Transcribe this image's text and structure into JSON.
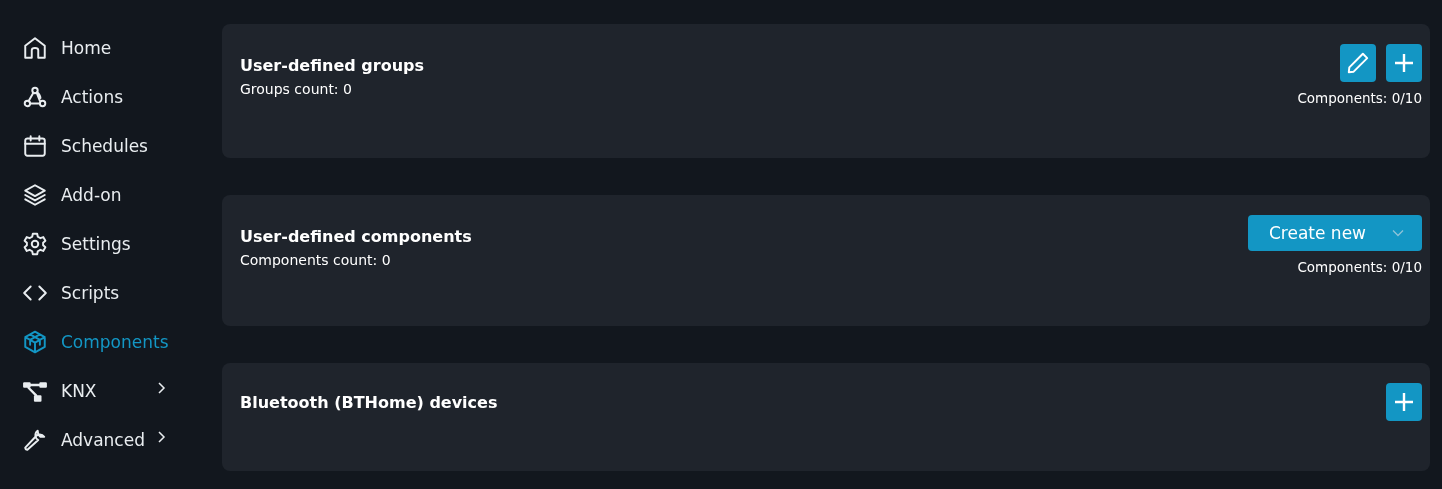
{
  "sidebar": {
    "items": [
      {
        "label": "Home",
        "selected": false,
        "has_submenu": false
      },
      {
        "label": "Actions",
        "selected": false,
        "has_submenu": false
      },
      {
        "label": "Schedules",
        "selected": false,
        "has_submenu": false
      },
      {
        "label": "Add-on",
        "selected": false,
        "has_submenu": false
      },
      {
        "label": "Settings",
        "selected": false,
        "has_submenu": false
      },
      {
        "label": "Scripts",
        "selected": false,
        "has_submenu": false
      },
      {
        "label": "Components",
        "selected": true,
        "has_submenu": false
      },
      {
        "label": "KNX",
        "selected": false,
        "has_submenu": true
      },
      {
        "label": "Advanced",
        "selected": false,
        "has_submenu": true
      }
    ]
  },
  "cards": [
    {
      "title": "User-defined groups",
      "subtitle": "Groups count: 0",
      "actions": [
        {
          "kind": "edit"
        },
        {
          "kind": "add"
        }
      ],
      "note": "Components: 0/10"
    },
    {
      "title": "User-defined components",
      "subtitle": "Components count: 0",
      "actions": [
        {
          "kind": "dropdown",
          "label": "Create new"
        }
      ],
      "note": "Components: 0/10"
    },
    {
      "title": "Bluetooth (BTHome) devices",
      "actions": [
        {
          "kind": "add"
        }
      ]
    }
  ]
}
